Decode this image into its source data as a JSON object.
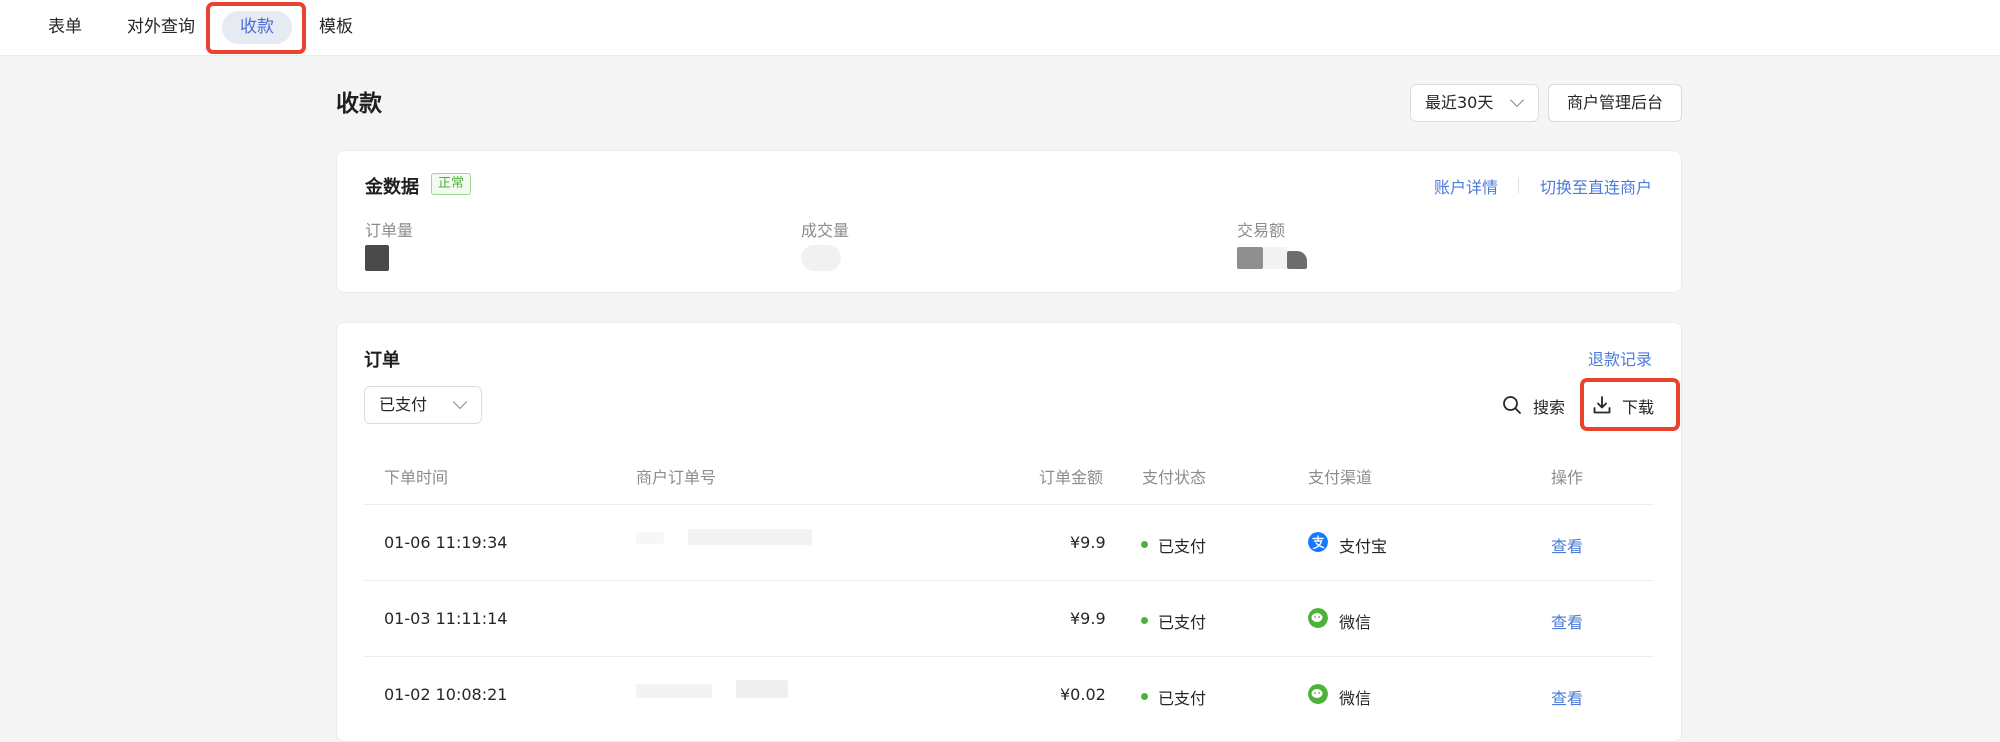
{
  "nav": {
    "tabs": [
      {
        "label": "表单"
      },
      {
        "label": "对外查询"
      },
      {
        "label": "收款"
      },
      {
        "label": "模板"
      }
    ]
  },
  "header": {
    "title": "收款",
    "date_range": "最近30天",
    "merchant_admin": "商户管理后台"
  },
  "summary": {
    "title": "金数据",
    "status": "正常",
    "account_details": "账户详情",
    "switch_merchant": "切换至直连商户",
    "stats": [
      {
        "label": "订单量"
      },
      {
        "label": "成交量"
      },
      {
        "label": "交易额"
      }
    ]
  },
  "orders": {
    "title": "订单",
    "refund_records": "退款记录",
    "filter_value": "已支付",
    "search_label": "搜索",
    "download_label": "下载",
    "columns": [
      "下单时间",
      "商户订单号",
      "订单金额",
      "支付状态",
      "支付渠道",
      "操作"
    ],
    "rows": [
      {
        "time": "01-06 11:19:34",
        "amount": "¥9.9",
        "status": "已支付",
        "channel": "支付宝",
        "channel_icon": "alipay-icon",
        "action": "查看"
      },
      {
        "time": "01-03 11:11:14",
        "amount": "¥9.9",
        "status": "已支付",
        "channel": "微信",
        "channel_icon": "wechat-icon",
        "action": "查看"
      },
      {
        "time": "01-02 10:08:21",
        "amount": "¥0.02",
        "status": "已支付",
        "channel": "微信",
        "channel_icon": "wechat-icon",
        "action": "查看"
      }
    ]
  },
  "colors": {
    "accent": "#4b7bd9",
    "highlight": "#e8432f",
    "status_green": "#4cb23b",
    "alipay": "#1677ff",
    "wechat": "#4cb23b"
  }
}
